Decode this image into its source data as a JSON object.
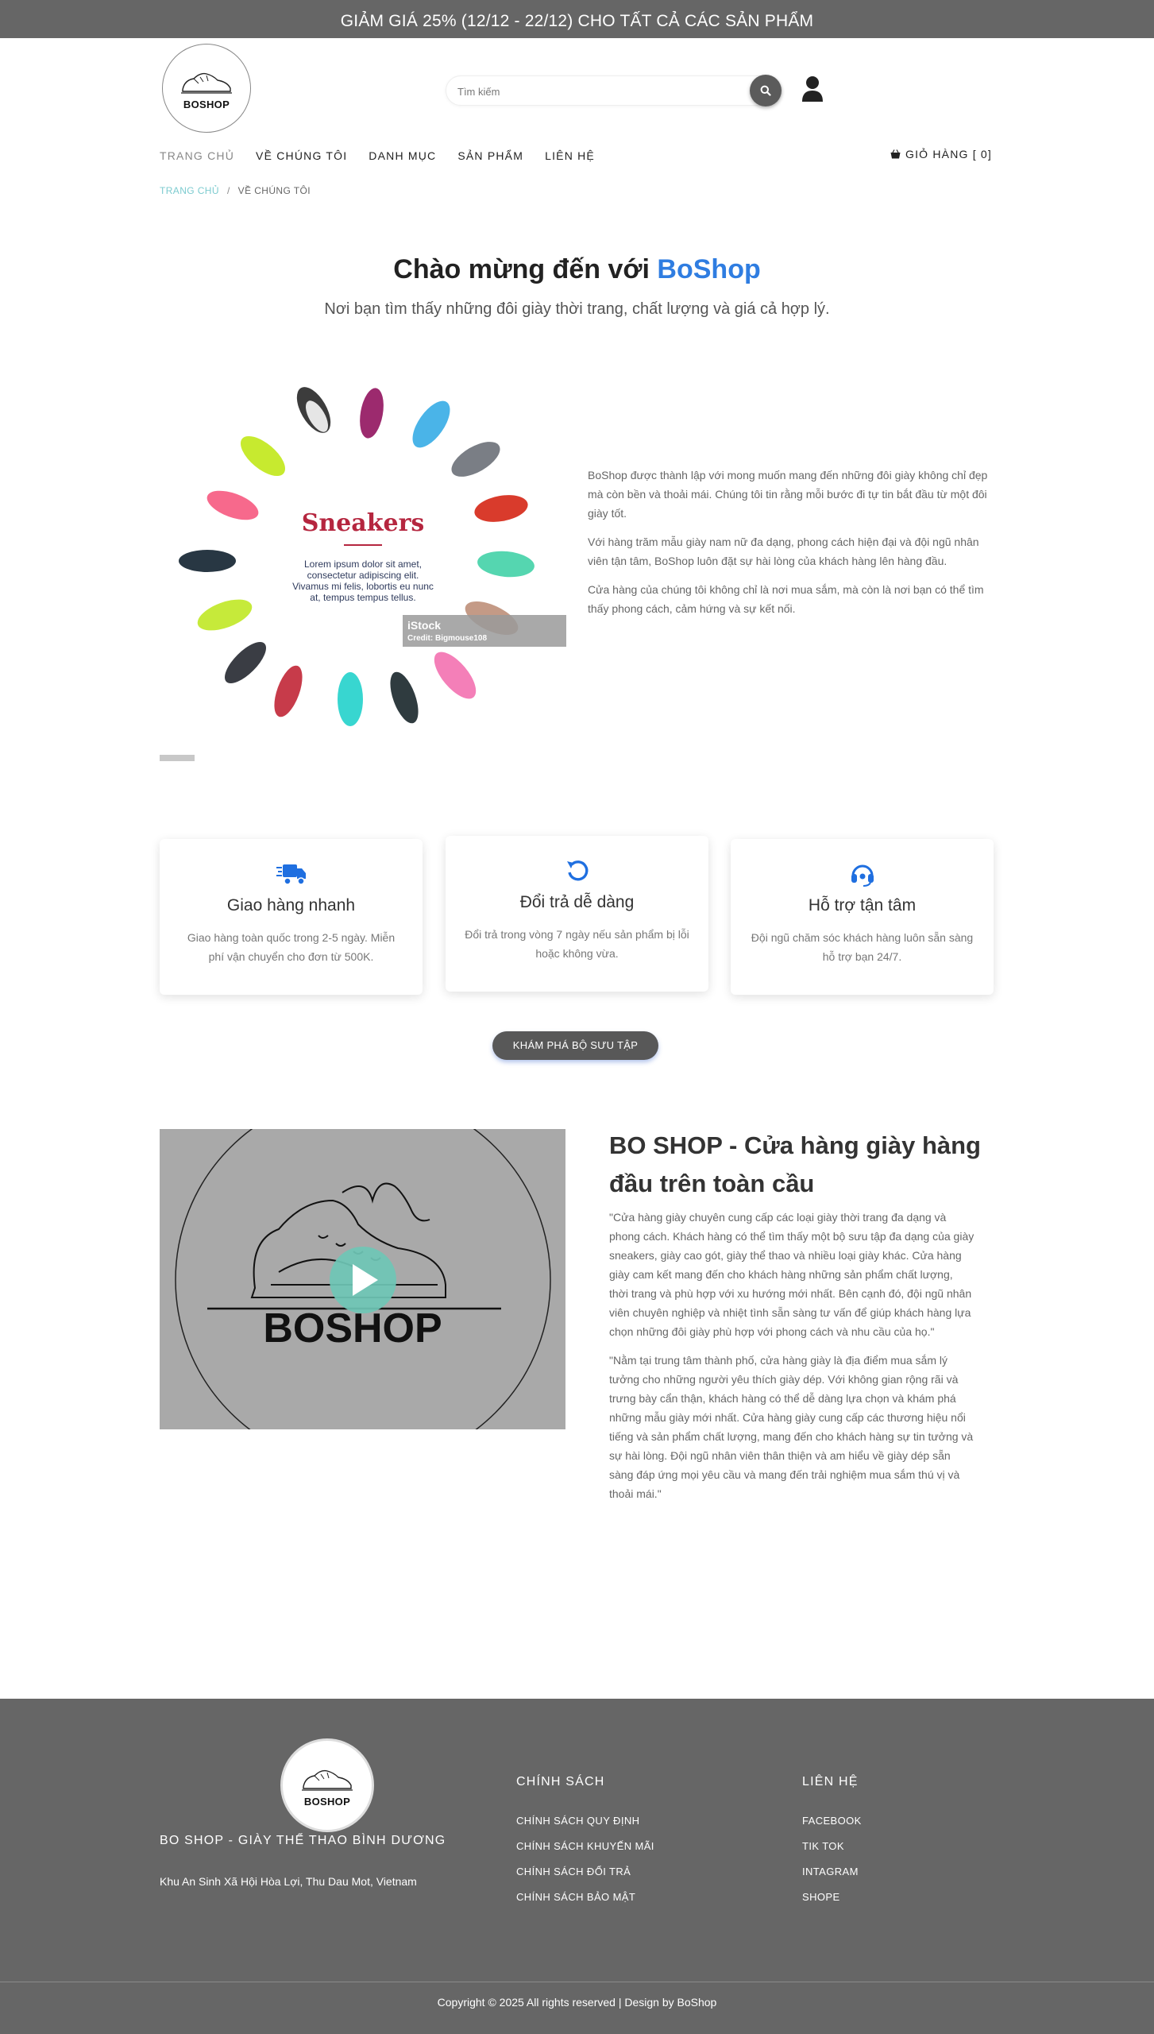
{
  "promo": {
    "text": "GIẢM GIÁ 25% (12/12 - 22/12) CHO TẤT CẢ CÁC SẢN PHẨM"
  },
  "header": {
    "logo_text": "BOSHOP",
    "search_placeholder": "Tìm kiếm",
    "icons": {
      "search": "search-icon",
      "user": "user-icon",
      "cart": "basket-icon"
    }
  },
  "nav": {
    "items": [
      {
        "label": "TRANG CHỦ"
      },
      {
        "label": "VỀ CHÚNG TÔI"
      },
      {
        "label": "DANH MỤC"
      },
      {
        "label": "SẢN PHẨM"
      },
      {
        "label": "LIÊN HỆ"
      }
    ],
    "cart_label": "GIỎ HÀNG [ 0]"
  },
  "breadcrumb": {
    "home": "TRANG CHỦ",
    "separator": "/",
    "current": "VỀ CHÚNG TÔI"
  },
  "hero": {
    "title_prefix": "Chào mừng đến với",
    "title_brand": "BoShop",
    "subtitle": "Nơi bạn tìm thấy những đôi giày thời trang, chất lượng và giá cả hợp lý."
  },
  "image": {
    "heading": "Sneakers",
    "lorem": [
      "Lorem ipsum dolor sit amet,",
      "consectetur adipiscing elit.",
      "Vivamus mi felis, lobortis eu nunc",
      "at, tempus tempus tellus."
    ],
    "watermark": "iStock",
    "credit": "Credit: Bigmouse108"
  },
  "about": {
    "paragraphs": [
      "BoShop được thành lập với mong muốn mang đến những đôi giày không chỉ đẹp mà còn bền và thoải mái. Chúng tôi tin rằng mỗi bước đi tự tin bắt đầu từ một đôi giày tốt.",
      "Với hàng trăm mẫu giày nam nữ đa dạng, phong cách hiện đại và đội ngũ nhân viên tận tâm, BoShop luôn đặt sự hài lòng của khách hàng lên hàng đầu.",
      "Cửa hàng của chúng tôi không chỉ là nơi mua sắm, mà còn là nơi bạn có thể tìm thấy phong cách, cảm hứng và sự kết nối."
    ]
  },
  "features": [
    {
      "icon": "truck-icon",
      "title": "Giao hàng nhanh",
      "desc": "Giao hàng toàn quốc trong 2-5 ngày. Miễn phí vận chuyển cho đơn từ 500K."
    },
    {
      "icon": "undo-icon",
      "title": "Đổi trả dễ dàng",
      "desc": "Đổi trả trong vòng 7 ngày nếu sản phẩm bị lỗi hoặc không vừa."
    },
    {
      "icon": "headset-icon",
      "title": "Hỗ trợ tận tâm",
      "desc": "Đội ngũ chăm sóc khách hàng luôn sẵn sàng hỗ trợ bạn 24/7."
    }
  ],
  "cta": {
    "label": "KHÁM PHÁ BỘ SƯU TẬP"
  },
  "video": {
    "logo_text": "BOSHOP"
  },
  "story": {
    "title": "BO SHOP - Cửa hàng giày hàng đầu trên toàn cầu",
    "paragraphs": [
      "\"Cửa hàng giày chuyên cung cấp các loại giày thời trang đa dạng và phong cách. Khách hàng có thể tìm thấy một bộ sưu tập đa dạng của giày sneakers, giày cao gót, giày thể thao và nhiều loại giày khác. Cửa hàng giày cam kết mang đến cho khách hàng những sản phẩm chất lượng, thời trang và phù hợp với xu hướng mới nhất. Bên cạnh đó, đội ngũ nhân viên chuyên nghiệp và nhiệt tình sẵn sàng tư vấn để giúp khách hàng lựa chọn những đôi giày phù hợp với phong cách và nhu cầu của họ.\"",
      "\"Nằm tại trung tâm thành phố, cửa hàng giày là địa điểm mua sắm lý tưởng cho những người yêu thích giày dép. Với không gian rộng rãi và trưng bày cẩn thận, khách hàng có thể dễ dàng lựa chọn và khám phá những mẫu giày mới nhất. Cửa hàng giày cung cấp các thương hiệu nổi tiếng và sản phẩm chất lượng, mang đến cho khách hàng sự tin tưởng và sự hài lòng. Đội ngũ nhân viên thân thiện và am hiểu về giày dép sẵn sàng đáp ứng mọi yêu cầu và mang đến trải nghiệm mua sắm thú vị và thoải mái.\""
    ]
  },
  "footer": {
    "logo_text": "BOSHOP",
    "brand": "BO SHOP - GIÀY THỂ THAO BÌNH DƯƠNG",
    "address": "Khu An Sinh Xã Hội Hòa Lợi, Thu Dau Mot, Vietnam",
    "policy_title": "CHÍNH SÁCH",
    "policy_items": [
      "CHÍNH SÁCH QUY ĐỊNH",
      "CHÍNH SÁCH KHUYẾN MÃI",
      "CHÍNH SÁCH ĐỔI TRẢ",
      "CHÍNH SÁCH BẢO MẬT"
    ],
    "contact_title": "LIÊN HỆ",
    "contact_items": [
      "FACEBOOK",
      "TIK TOK",
      "INTAGRAM",
      "SHOPE"
    ],
    "copyright": "Copyright © 2025 All rights reserved | Design by BoShop"
  },
  "colors": {
    "accent_blue": "#2f7de1",
    "footer_bg": "#666666",
    "promo_bg": "#666666",
    "breadcrumb_link": "#7ccbcf",
    "play_teal": "#6fc7b6"
  }
}
